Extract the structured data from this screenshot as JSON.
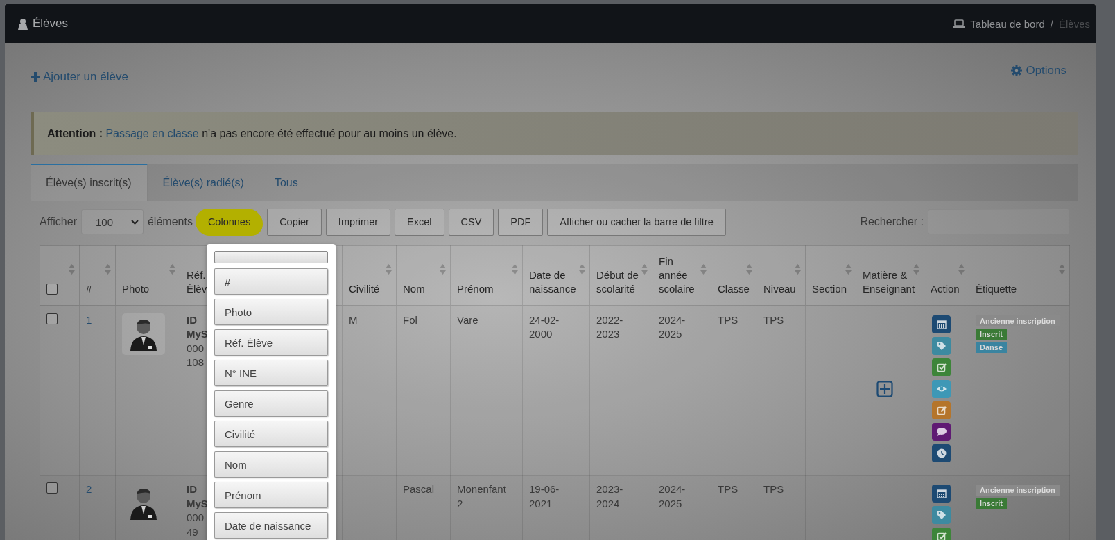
{
  "topbar": {
    "title": "Élèves",
    "separator": "/",
    "breadcrumb": [
      {
        "label": "Tableau de bord",
        "current": false
      },
      {
        "label": "Élèves",
        "current": true
      }
    ]
  },
  "add_link": "Ajouter un élève",
  "options_link": "Options",
  "alert": {
    "label": "Attention :",
    "link": "Passage en classe",
    "text": "n'a pas encore été effectué pour au moins un élève."
  },
  "tabs": [
    {
      "label": "Élève(s) inscrit(s)",
      "selected": true
    },
    {
      "label": "Élève(s) radié(s)",
      "selected": false
    },
    {
      "label": "Tous",
      "selected": false
    }
  ],
  "toolbar": {
    "show_label": "Afficher",
    "page_size": "100",
    "show_suffix": "éléments",
    "search_label": "Rechercher :",
    "buttons": [
      {
        "label": "Colonnes",
        "highlighted": true
      },
      {
        "label": "Copier",
        "highlighted": false
      },
      {
        "label": "Imprimer",
        "highlighted": false
      },
      {
        "label": "Excel",
        "highlighted": false
      },
      {
        "label": "CSV",
        "highlighted": false
      },
      {
        "label": "PDF",
        "highlighted": false
      },
      {
        "label": "Afficher ou cacher la barre de filtre",
        "highlighted": false
      }
    ]
  },
  "table": {
    "columns": [
      {
        "kind": "checkbox",
        "checked": false,
        "sortable": true
      },
      {
        "kind": "text",
        "label": "#",
        "sortable": true
      },
      {
        "kind": "text",
        "label": "Photo",
        "sortable": true
      },
      {
        "kind": "text",
        "label": "Réf. Élèv",
        "sortable": false
      },
      {
        "kind": "text",
        "label": "Civilité",
        "sortable": true
      },
      {
        "kind": "text",
        "label": "Nom",
        "sortable": true
      },
      {
        "kind": "text",
        "label": "Prénom",
        "sortable": true
      },
      {
        "kind": "text",
        "label": "Date de naissance",
        "sortable": true
      },
      {
        "kind": "text",
        "label": "Début de scolarité",
        "sortable": true
      },
      {
        "kind": "text",
        "label": "Fin année scolaire",
        "sortable": true
      },
      {
        "kind": "text",
        "label": "Classe",
        "sortable": true
      },
      {
        "kind": "text",
        "label": "Niveau",
        "sortable": true
      },
      {
        "kind": "text",
        "label": "Section",
        "sortable": true
      },
      {
        "kind": "text",
        "label": "Matière & Enseignant",
        "sortable": true
      },
      {
        "kind": "text",
        "label": "Action",
        "sortable": true
      },
      {
        "kind": "text",
        "label": "Étiquette",
        "sortable": true
      }
    ],
    "rows": [
      {
        "checked": false,
        "number": "1",
        "photo_framed": true,
        "ref": [
          "ID",
          "MyS",
          "000",
          "108"
        ],
        "civilite": "M",
        "nom": "Fol",
        "prenom": "Vare",
        "naissance": "24-02-2000",
        "debut": "2022-2023",
        "fin": "2024-2025",
        "classe": "TPS",
        "niveau": "TPS",
        "matiere_add": true,
        "actions": [
          {
            "kind": "calendar"
          },
          {
            "kind": "tag"
          },
          {
            "kind": "check"
          },
          {
            "kind": "eye"
          },
          {
            "kind": "edit"
          },
          {
            "kind": "comment"
          },
          {
            "kind": "clock"
          }
        ],
        "labels": [
          {
            "text": "Ancienne inscription",
            "color": "#8a8a8a"
          },
          {
            "text": "Inscrit",
            "color": "#3a7a36"
          },
          {
            "text": "Danse",
            "color": "#3a84a0"
          }
        ]
      },
      {
        "checked": false,
        "number": "2",
        "photo_framed": false,
        "ref": [
          "ID",
          "MyS",
          "000",
          "49"
        ],
        "nom": "Pascal",
        "prenom": "Monenfant 2",
        "naissance": "19-06-2021",
        "debut": "2023-2024",
        "fin": "2024-2025",
        "classe": "TPS",
        "niveau": "TPS",
        "matiere_add": false,
        "actions": [
          {
            "kind": "calendar"
          },
          {
            "kind": "tag"
          },
          {
            "kind": "check"
          }
        ],
        "labels": [
          {
            "text": "Ancienne inscription",
            "color": "#8a8a8a"
          },
          {
            "text": "Inscrit",
            "color": "#3a7a36"
          }
        ]
      }
    ]
  },
  "columns_menu": [
    "#",
    "Photo",
    "Réf. Élève",
    "N° INE",
    "Genre",
    "Civilité",
    "Nom",
    "Prénom",
    "Date de naissance"
  ]
}
